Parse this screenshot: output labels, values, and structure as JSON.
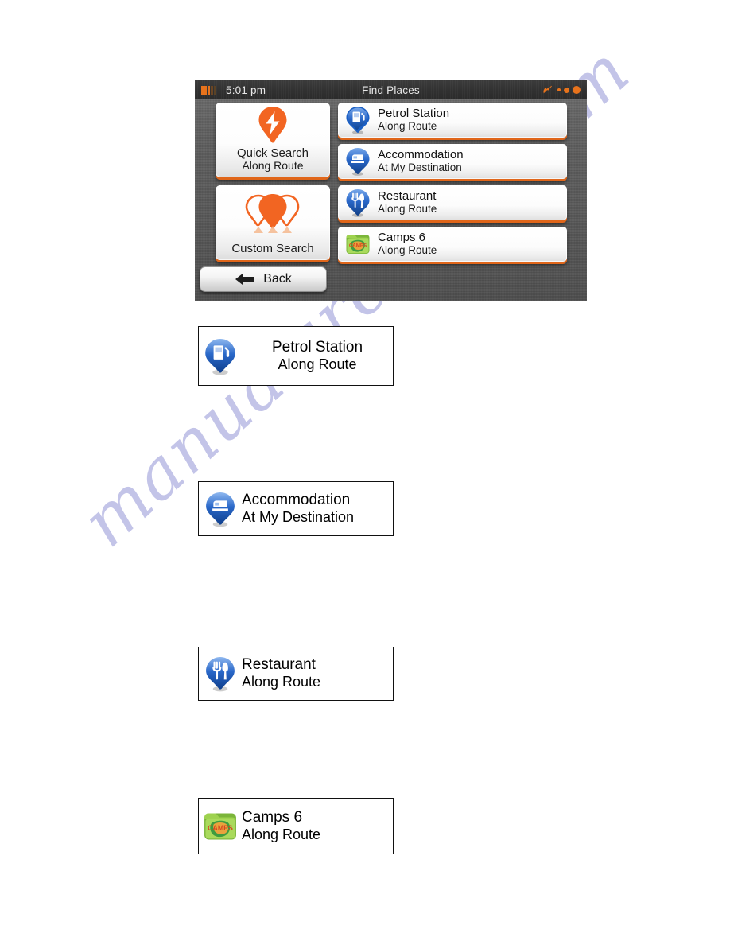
{
  "watermark": {
    "text": "manualarchive.com"
  },
  "device": {
    "statusbar": {
      "battery_icon": "battery-icon",
      "time": "5:01 pm",
      "title": "Find Places",
      "satellite_icon": "satellite-dish-icon",
      "signal_dots": 3
    },
    "tiles": [
      {
        "icon": "pin-lightning-icon",
        "main": "Quick Search",
        "sub": "Along Route"
      },
      {
        "icon": "pin-group-icon",
        "main": "Custom Search",
        "sub": ""
      }
    ],
    "rows": [
      {
        "icon": "pin-fuel-icon",
        "main": "Petrol Station",
        "sub": "Along Route"
      },
      {
        "icon": "pin-bed-icon",
        "main": "Accommodation",
        "sub": "At My Destination"
      },
      {
        "icon": "pin-cutlery-icon",
        "main": "Restaurant",
        "sub": "Along Route"
      },
      {
        "icon": "camps-folder-icon",
        "main": "Camps 6",
        "sub": "Along Route"
      }
    ],
    "back_button": {
      "icon": "arrow-left-icon",
      "label": "Back"
    }
  },
  "figures": [
    {
      "icon": "pin-fuel-icon",
      "main": "Petrol Station",
      "sub": "Along Route"
    },
    {
      "icon": "pin-bed-icon",
      "main": "Accommodation",
      "sub": "At My Destination"
    },
    {
      "icon": "pin-cutlery-icon",
      "main": "Restaurant",
      "sub": "Along Route"
    },
    {
      "icon": "camps-folder-icon",
      "main": "Camps 6",
      "sub": "Along Route"
    }
  ],
  "colors": {
    "accent_orange": "#e8731c",
    "tile_underline": "#e0661a",
    "pin_blue": "#1a5fc4",
    "camps_green": "#8cc63f",
    "watermark": "#b9bae4",
    "device_bg": "#5e5e5e",
    "statusbar_bg": "#313131"
  }
}
